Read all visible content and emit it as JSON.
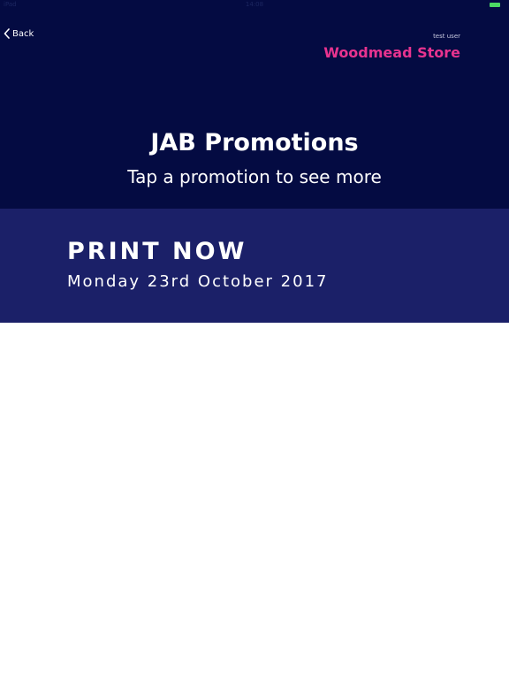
{
  "status_bar": {
    "left": "iPad",
    "time": "14:08"
  },
  "nav": {
    "back_label": "Back"
  },
  "header": {
    "user_label": "test user",
    "store_name": "Woodmead Store",
    "title": "JAB Promotions",
    "subtitle": "Tap a promotion to see more"
  },
  "promotions": [
    {
      "title": "PRINT NOW",
      "date": "Monday 23rd October 2017"
    }
  ],
  "colors": {
    "header_bg": "#040b42",
    "promo_bg": "#1b2068",
    "store_accent": "#e8338f",
    "battery": "#4cd964"
  }
}
